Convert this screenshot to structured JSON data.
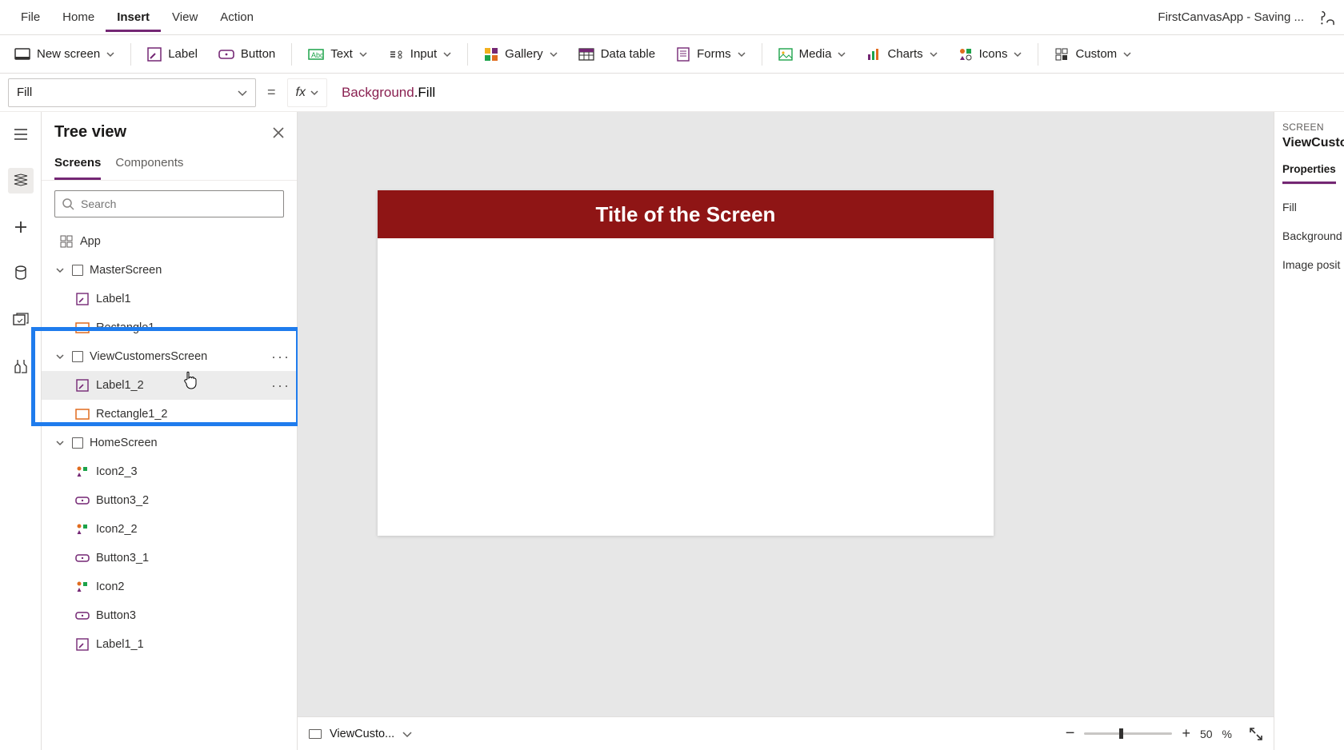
{
  "menubar": {
    "file": "File",
    "home": "Home",
    "insert": "Insert",
    "view": "View",
    "action": "Action",
    "app_title": "FirstCanvasApp - Saving ..."
  },
  "ribbon": {
    "new_screen": "New screen",
    "label": "Label",
    "button": "Button",
    "text": "Text",
    "input": "Input",
    "gallery": "Gallery",
    "data_table": "Data table",
    "forms": "Forms",
    "media": "Media",
    "charts": "Charts",
    "icons": "Icons",
    "custom": "Custom"
  },
  "formula": {
    "property": "Fill",
    "equals": "=",
    "fx": "fx",
    "token_obj": "Background",
    "token_prop": ".Fill"
  },
  "tree": {
    "title": "Tree view",
    "tab_screens": "Screens",
    "tab_components": "Components",
    "search_placeholder": "Search",
    "app": "App",
    "master": "MasterScreen",
    "label1": "Label1",
    "rect1": "Rectangle1",
    "viewcust": "ViewCustomersScreen",
    "label1_2": "Label1_2",
    "rect1_2": "Rectangle1_2",
    "home": "HomeScreen",
    "icon2_3": "Icon2_3",
    "button3_2": "Button3_2",
    "icon2_2": "Icon2_2",
    "button3_1": "Button3_1",
    "icon2": "Icon2",
    "button3": "Button3",
    "label1_1": "Label1_1",
    "more": "···"
  },
  "canvas": {
    "banner_text": "Title of the Screen"
  },
  "bottom": {
    "screen_name": "ViewCusto...",
    "zoom_value": "50",
    "zoom_unit": "%"
  },
  "properties": {
    "section": "SCREEN",
    "name": "ViewCusto",
    "tab": "Properties",
    "fill": "Fill",
    "background": "Background",
    "imageposition": "Image posit"
  }
}
